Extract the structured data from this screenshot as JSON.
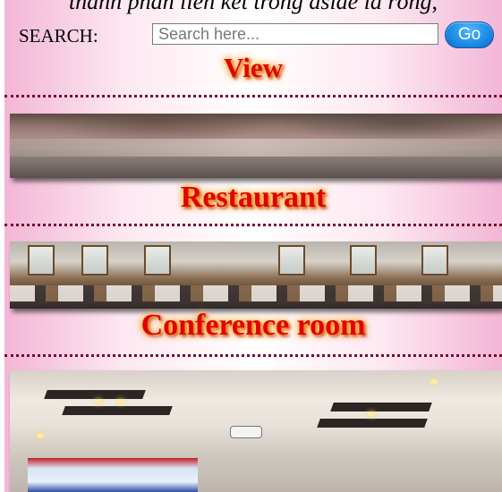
{
  "page": {
    "top_cut_text": "thành phần liên kết trong aside là rỗng,"
  },
  "search": {
    "label": "SEARCH:",
    "placeholder": "Search here...",
    "value": "",
    "go_label": "Go"
  },
  "sections": {
    "view": {
      "title": "View"
    },
    "restaurant": {
      "title": "Restaurant"
    },
    "conference_room": {
      "title": "Conference room"
    }
  },
  "photos": {
    "lake": {
      "alt": "lake-view-photo"
    },
    "restaurant": {
      "alt": "restaurant-photo"
    },
    "conference": {
      "alt": "conference-room-photo"
    }
  },
  "colors": {
    "heading": "#e10000",
    "glow": "#ff8a00",
    "go_button": "#1f8ee8",
    "divider": "#7a0a2a"
  }
}
